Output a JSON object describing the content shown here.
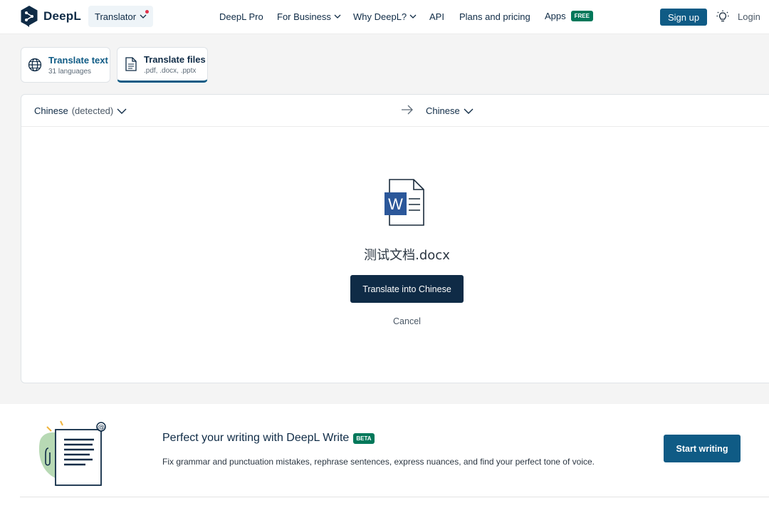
{
  "header": {
    "logo_text": "DeepL",
    "translator_label": "Translator",
    "nav": {
      "deepl_pro": "DeepL Pro",
      "for_business": "For Business",
      "why_deepl": "Why DeepL?",
      "api": "API",
      "plans": "Plans and pricing",
      "apps": "Apps",
      "apps_badge": "FREE"
    },
    "signup_label": "Sign up",
    "login_label": "Login"
  },
  "mode_tabs": {
    "text": {
      "title": "Translate text",
      "subtitle": "31 languages",
      "icon": "globe-icon"
    },
    "files": {
      "title": "Translate files",
      "subtitle": ".pdf, .docx, .pptx",
      "icon": "document-icon",
      "active": true
    }
  },
  "translator": {
    "source_language": "Chinese",
    "source_suffix": "(detected)",
    "target_language": "Chinese",
    "file_icon": "word-doc-icon",
    "file_icon_letter": "W",
    "file_name": "测试文档.docx",
    "translate_button": "Translate into Chinese",
    "cancel_label": "Cancel"
  },
  "promo": {
    "title": "Perfect your writing with DeepL Write",
    "badge": "BETA",
    "description": "Fix grammar and punctuation mistakes, rephrase sentences, express nuances, and find your perfect tone of voice.",
    "button": "Start writing"
  },
  "colors": {
    "brand_navy": "#0f2b46",
    "brand_blue": "#0f5b85",
    "badge_green": "#00785a",
    "word_blue": "#2b579a"
  }
}
